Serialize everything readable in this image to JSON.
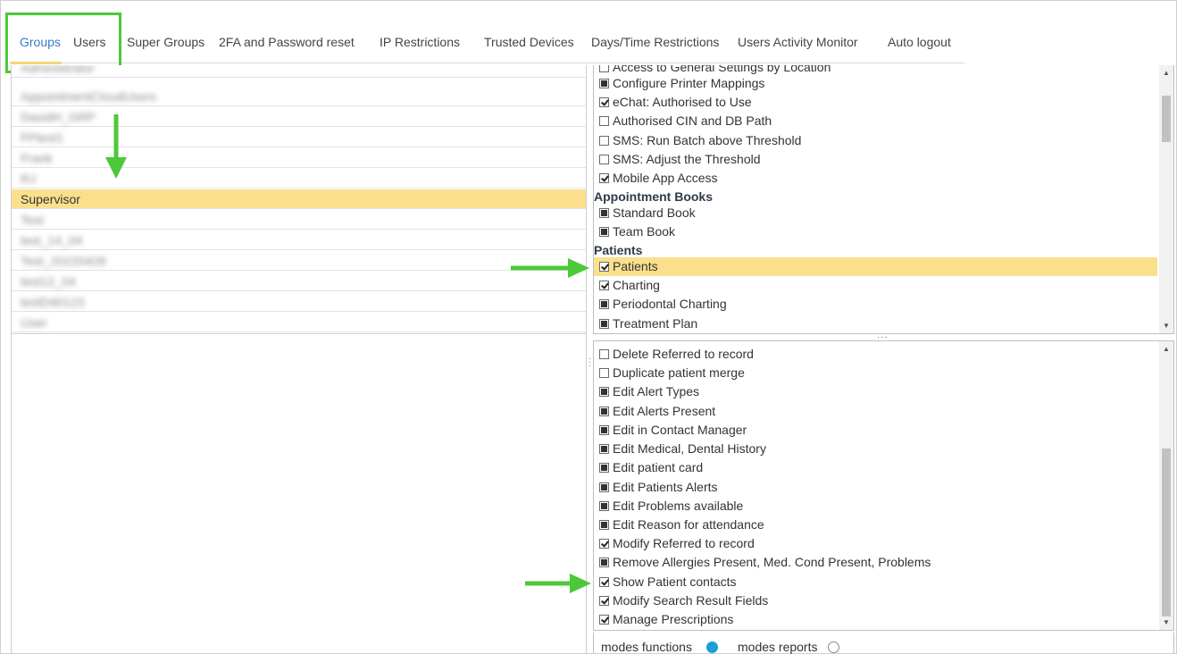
{
  "tabs": [
    {
      "label": "Groups",
      "active": true
    },
    {
      "label": "Users"
    },
    {
      "label": "Super Groups"
    },
    {
      "label": "2FA and Password reset"
    },
    {
      "label": "IP Restrictions"
    },
    {
      "label": "Trusted Devices"
    },
    {
      "label": "Days/Time Restrictions"
    },
    {
      "label": "Users Activity Monitor"
    },
    {
      "label": "Auto logout"
    }
  ],
  "groups": {
    "rows": [
      "Administrator",
      "AppointmentCloudUsers",
      "DavidH_GRP",
      "FPtest1",
      "Frank",
      "RJ",
      "Supervisor",
      "Test",
      "test_14_04",
      "Test_20220426",
      "test12_04",
      "testD40123",
      "User"
    ],
    "selected": "Supervisor"
  },
  "permissions_top": {
    "items": [
      {
        "label": "Access to General Settings by Location",
        "state": "unchecked"
      },
      {
        "label": "Configure Printer Mappings",
        "state": "partial"
      },
      {
        "label": "eChat: Authorised to Use",
        "state": "checked"
      },
      {
        "label": "Authorised CIN and DB Path",
        "state": "unchecked"
      },
      {
        "label": "SMS: Run Batch above Threshold",
        "state": "unchecked"
      },
      {
        "label": "SMS: Adjust the Threshold",
        "state": "unchecked"
      },
      {
        "label": "Mobile App Access",
        "state": "checked"
      },
      {
        "section": "Appointment Books"
      },
      {
        "label": "Standard Book",
        "state": "partial"
      },
      {
        "label": "Team Book",
        "state": "partial"
      },
      {
        "section": "Patients"
      },
      {
        "label": "Patients",
        "state": "checked",
        "selected": true
      },
      {
        "label": "Charting",
        "state": "checked"
      },
      {
        "label": "Periodontal Charting",
        "state": "partial"
      },
      {
        "label": "Treatment Plan",
        "state": "partial"
      }
    ]
  },
  "permissions_bottom": {
    "items": [
      {
        "label": "Delete Referred to record",
        "state": "unchecked"
      },
      {
        "label": "Duplicate patient merge",
        "state": "unchecked"
      },
      {
        "label": "Edit Alert Types",
        "state": "partial"
      },
      {
        "label": "Edit Alerts Present",
        "state": "partial"
      },
      {
        "label": "Edit in Contact Manager",
        "state": "partial"
      },
      {
        "label": "Edit Medical, Dental History",
        "state": "partial"
      },
      {
        "label": "Edit patient card",
        "state": "partial"
      },
      {
        "label": "Edit Patients Alerts",
        "state": "partial"
      },
      {
        "label": "Edit Problems available",
        "state": "partial"
      },
      {
        "label": "Edit Reason for attendance",
        "state": "partial"
      },
      {
        "label": "Modify Referred to record",
        "state": "checked"
      },
      {
        "label": "Remove Allergies Present, Med. Cond Present, Problems",
        "state": "partial"
      },
      {
        "label": "Show Patient contacts",
        "state": "checked"
      },
      {
        "label": "Modify Search Result Fields",
        "state": "checked"
      },
      {
        "label": "Manage Prescriptions",
        "state": "checked"
      }
    ]
  },
  "modes": {
    "functions_label": "modes functions",
    "reports_label": "modes reports",
    "selected": "functions"
  },
  "colors": {
    "accent": "#3a7bc8",
    "selection": "#fae08c",
    "annotation": "#4dc83a",
    "radio_on": "#1a9fd6"
  }
}
